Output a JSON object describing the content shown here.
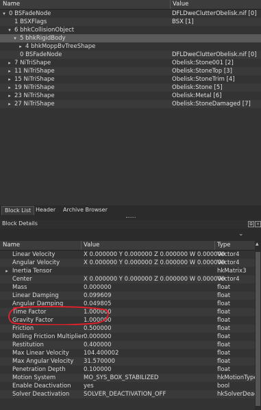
{
  "tree": {
    "col_name": "Name",
    "col_value": "Value",
    "rows": [
      {
        "name": "0 BSFadeNode",
        "value": "DFLDweClutterObelisk.nif [0]",
        "arrow": "▾"
      },
      {
        "name": "1 BSXFlags",
        "value": "BSX [1]",
        "arrow": ""
      },
      {
        "name": "6 bhkCollisionObject",
        "value": "",
        "arrow": "▾"
      },
      {
        "name": "5 bhkRigidBody",
        "value": "",
        "arrow": "▾"
      },
      {
        "name": "4 bhkMoppBvTreeShape",
        "value": "",
        "arrow": "▸"
      },
      {
        "name": "0 BSFadeNode",
        "value": "DFLDweClutterObelisk.nif [0]",
        "arrow": ""
      },
      {
        "name": "7 NiTriShape",
        "value": "Obelisk:Stone001 [2]",
        "arrow": "▸"
      },
      {
        "name": "11 NiTriShape",
        "value": "Obelisk:StoneTop [3]",
        "arrow": "▸"
      },
      {
        "name": "15 NiTriShape",
        "value": "Obelisk:StoneTrim [4]",
        "arrow": "▸"
      },
      {
        "name": "19 NiTriShape",
        "value": "Obelisk:Stone [5]",
        "arrow": "▸"
      },
      {
        "name": "23 NiTriShape",
        "value": "Obelisk:Metal [6]",
        "arrow": "▸"
      },
      {
        "name": "27 NiTriShape",
        "value": "Obelisk:StoneDamaged [7]",
        "arrow": "▸"
      }
    ]
  },
  "tabs": [
    "Block List",
    "Header",
    "Archive Browser"
  ],
  "block_details": {
    "title": "Block Details",
    "col_name": "Name",
    "col_value": "Value",
    "col_type": "Type",
    "rows": [
      {
        "name": "Linear Velocity",
        "value": "X 0.000000 Y 0.000000 Z 0.000000 W 0.000000",
        "type": "Vector4"
      },
      {
        "name": "Angular Velocity",
        "value": "X 0.000000 Y 0.000000 Z 0.000000 W 0.000000",
        "type": "Vector4"
      },
      {
        "name": "Inertia Tensor",
        "value": "",
        "type": "hkMatrix3"
      },
      {
        "name": "Center",
        "value": "X 0.000000 Y 0.000000 Z 0.000000 W 0.000000",
        "type": "Vector4"
      },
      {
        "name": "Mass",
        "value": "0.000000",
        "type": "float"
      },
      {
        "name": "Linear Damping",
        "value": "0.099609",
        "type": "float"
      },
      {
        "name": "Angular Damping",
        "value": "0.049805",
        "type": "float"
      },
      {
        "name": "Time Factor",
        "value": "1.000000",
        "type": "float"
      },
      {
        "name": "Gravity Factor",
        "value": "1.000000",
        "type": "float"
      },
      {
        "name": "Friction",
        "value": "0.500000",
        "type": "float"
      },
      {
        "name": "Rolling Friction Multiplier",
        "value": "0.000000",
        "type": "float"
      },
      {
        "name": "Restitution",
        "value": "0.400000",
        "type": "float"
      },
      {
        "name": "Max Linear Velocity",
        "value": "104.400002",
        "type": "float"
      },
      {
        "name": "Max Angular Velocity",
        "value": "31.570000",
        "type": "float"
      },
      {
        "name": "Penetration Depth",
        "value": "0.100000",
        "type": "float"
      },
      {
        "name": "Motion System",
        "value": "MO_SYS_BOX_STABILIZED",
        "type": "hkMotionType"
      },
      {
        "name": "Enable Deactivation",
        "value": "yes",
        "type": "bool"
      },
      {
        "name": "Solver Deactivation",
        "value": "SOLVER_DEACTIVATION_OFF",
        "type": "hkSolverDeact"
      }
    ]
  },
  "colors": {
    "highlight_circle": "#e0202a",
    "selected_row": "#5a5a5a"
  }
}
